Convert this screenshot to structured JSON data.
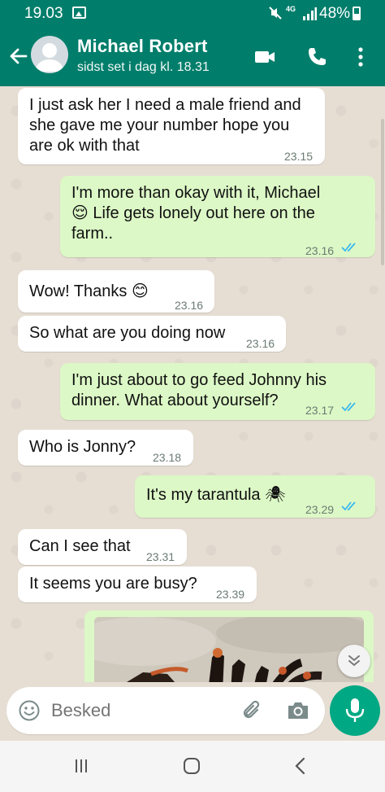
{
  "status_bar": {
    "time": "19.03",
    "network": "4G",
    "battery": "48%",
    "icons": [
      "gallery-icon",
      "mute-icon",
      "signal-icon",
      "battery-icon"
    ]
  },
  "header": {
    "name": "Michael Robert",
    "last_seen": "sidst set i dag kl. 18.31",
    "icons": [
      "back-arrow-icon",
      "avatar",
      "video-call-icon",
      "phone-icon",
      "more-options-icon"
    ],
    "color": "#007e6b"
  },
  "messages": [
    {
      "dir": "in",
      "text": "I just ask her I need a male friend and\nshe gave me your number hope you\nare ok with that",
      "time": "23.15"
    },
    {
      "dir": "out",
      "text": "I'm more than okay with it, Michael\n😌 Life gets lonely out here on the\nfarm..",
      "time": "23.16",
      "read": true
    },
    {
      "dir": "in",
      "text": "Wow! Thanks 😊",
      "time": "23.16"
    },
    {
      "dir": "in",
      "text": "So what are you doing now",
      "time": "23.16"
    },
    {
      "dir": "out",
      "text": "I'm just about to go feed Johnny his\ndinner. What about yourself?",
      "time": "23.17",
      "read": true
    },
    {
      "dir": "in",
      "text": "Who is Jonny?",
      "time": "23.18"
    },
    {
      "dir": "out",
      "text": "It's my tarantula 🕷",
      "time": "23.29",
      "read": true
    },
    {
      "dir": "in",
      "text": "Can I see that",
      "time": "23.31"
    },
    {
      "dir": "in",
      "text": "It seems you are busy?",
      "time": "23.39"
    }
  ],
  "photo_message": {
    "dir": "out",
    "content": "tarantula-photo"
  },
  "input": {
    "placeholder": "Besked"
  },
  "colors": {
    "outgoing": "#dcf8c6",
    "incoming": "#ffffff",
    "read_ticks": "#34b7f1",
    "accent": "#00a884"
  }
}
